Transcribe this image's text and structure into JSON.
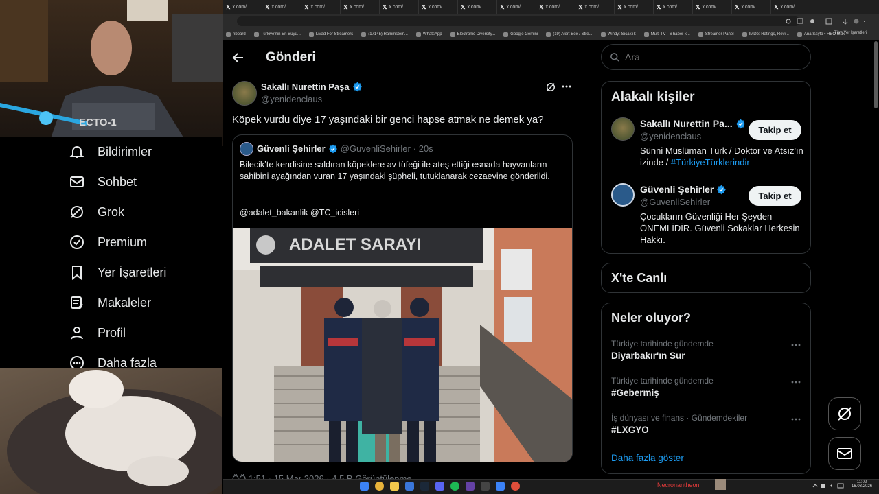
{
  "browser": {
    "tabs": [
      "x.com/",
      "x.com/",
      "x.com/",
      "x.com/",
      "x.com/",
      "x.com/",
      "x.com/",
      "x.com/",
      "x.com/",
      "x.com/",
      "x.com/",
      "x.com/",
      "x.com/",
      "x.com/",
      "x.com/"
    ],
    "bookmarks": [
      "nboard",
      "Türkiye'nin En Büyü...",
      "Livad For Streamers",
      "(17145) Rammstein...",
      "WhatsApp",
      "Electronic Diversity...",
      "Google Gemini",
      "(19) Alert Box / Stre...",
      "Windy: Sıcaklık",
      "Multi TV - 6 haber k...",
      "Streamer Panel",
      "IMDb: Ratings, Revi...",
      "Ana Sayfa • HBO Max"
    ],
    "all_bookmarks": "Tüm Yer İşaretleri"
  },
  "nav": {
    "items": [
      {
        "label": "Bildirimler",
        "icon": "bell-icon"
      },
      {
        "label": "Sohbet",
        "icon": "mail-icon"
      },
      {
        "label": "Grok",
        "icon": "grok-icon"
      },
      {
        "label": "Premium",
        "icon": "verified-badge-icon"
      },
      {
        "label": "Yer İşaretleri",
        "icon": "bookmark-icon"
      },
      {
        "label": "Makaleler",
        "icon": "article-icon"
      },
      {
        "label": "Profil",
        "icon": "person-icon"
      },
      {
        "label": "Daha fazla",
        "icon": "more-circle-icon"
      }
    ]
  },
  "header": {
    "title": "Gönderi"
  },
  "post": {
    "author_name": "Sakallı Nurettin Paşa",
    "author_handle": "@yenidenclaus",
    "text": "Köpek vurdu diye 17 yaşındaki bir genci hapse atmak ne demek ya?",
    "quote": {
      "author_name": "Güvenli Şehirler",
      "author_handle": "@GuvenliSehirler",
      "time": "· 20s",
      "text": "Bilecik’te kendisine saldıran köpeklere av tüfeği ile ateş ettiği esnada hayvanların sahibini ayağından vuran 17 yaşındaki şüpheli, tutuklanarak cezaevine gönderildi.",
      "mentions": "@adalet_bakanlik @TC_icisleri",
      "image_sign": "ADALET SARAYI"
    },
    "meta_partial": "ÖÖ 1:51 · 15 Mar 2026 · 4,5 B Görüntülenme"
  },
  "right": {
    "search_placeholder": "Ara",
    "related_title": "Alakalı kişiler",
    "related": [
      {
        "name": "Sakallı Nurettin Pa...",
        "handle": "@yenidenclaus",
        "bio": "Sünni Müslüman Türk / Doktor ve Atsız'ın izinde / ",
        "bio_tag": "#TürkiyeTürklerindir",
        "follow": "Takip et"
      },
      {
        "name": "Güvenli Şehirler",
        "handle": "@GuvenliSehirler",
        "bio": "Çocukların Güvenliği Her Şeyden ÖNEMLİDİR. Güvenli Sokaklar Herkesin Hakkı.",
        "follow": "Takip et"
      }
    ],
    "live_title": "X'te Canlı",
    "trends_title": "Neler oluyor?",
    "trends": [
      {
        "context": "Türkiye tarihinde gündemde",
        "name": "Diyarbakır'ın Sur"
      },
      {
        "context": "Türkiye tarihinde gündemde",
        "name": "#Gebermiş"
      },
      {
        "context": "İş dünyası ve finans · Gündemdekiler",
        "name": "#LXGYO"
      }
    ],
    "show_more": "Daha fazla göster"
  },
  "taskbar": {
    "stream_name": "Necronantheon",
    "clock_time": "11:02",
    "clock_date": "16.03.2026"
  },
  "colors": {
    "accent": "#1d9bf0",
    "background": "#000000",
    "border": "#2f3336",
    "muted": "#71767b"
  }
}
